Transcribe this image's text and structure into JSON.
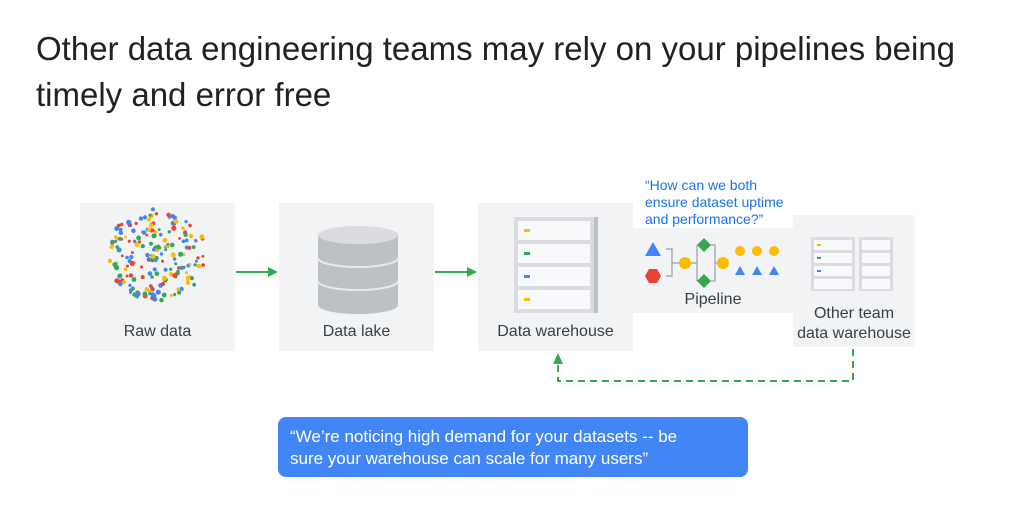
{
  "title": "Other data engineering teams may rely on your pipelines being timely and error free",
  "stages": {
    "raw_data": "Raw data",
    "data_lake": "Data lake",
    "data_warehouse": "Data warehouse",
    "pipeline": "Pipeline",
    "other_team_line1": "Other team",
    "other_team_line2": "data warehouse"
  },
  "quotes": {
    "top_line1": "“How can we both",
    "top_line2": "ensure dataset uptime",
    "top_line3": "and performance?”",
    "bottom_line1": "“We’re noticing high demand for your datasets -- be",
    "bottom_line2": "sure your warehouse can scale for many users”"
  },
  "colors": {
    "arrow": "#34a853",
    "blue": "#4285f4",
    "red": "#ea4335",
    "yellow": "#fbbc04",
    "green": "#34a853",
    "panel": "#f1f3f4"
  }
}
